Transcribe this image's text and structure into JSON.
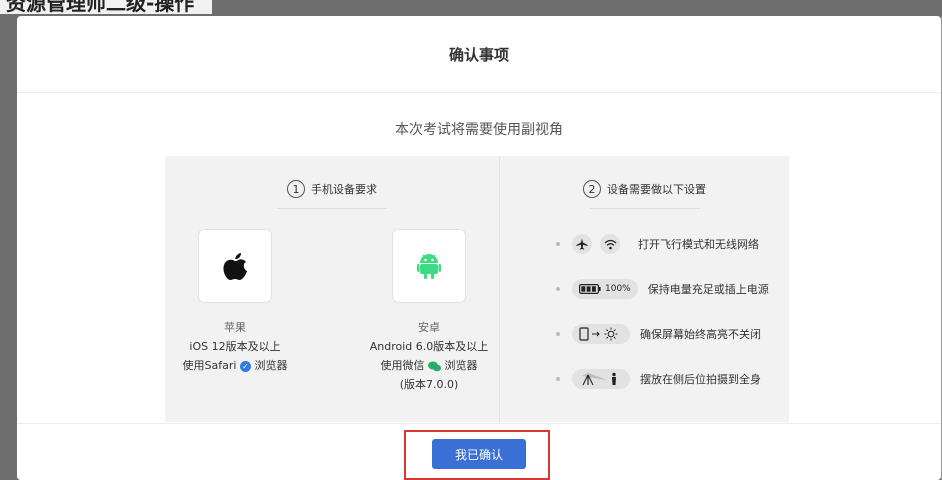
{
  "backdrop": {
    "title": "资源管理师二级-操作"
  },
  "modal": {
    "title": "确认事项",
    "subtitle": "本次考试将需要使用副视角",
    "confirm_label": "我已确认"
  },
  "steps": [
    {
      "number": "1",
      "label": "手机设备要求",
      "devices": [
        {
          "icon": "apple-logo-icon",
          "name": "苹果",
          "line1": "iOS 12版本及以上",
          "line2_prefix": "使用Safari",
          "line2_suffix": "浏览器",
          "line3": ""
        },
        {
          "icon": "android-logo-icon",
          "name": "安卓",
          "line1": "Android 6.0版本及以上",
          "line2_prefix": "使用微信",
          "line2_suffix": "浏览器",
          "line3": "(版本7.0.0)"
        }
      ]
    },
    {
      "number": "2",
      "label": "设备需要做以下设置",
      "requirements": [
        {
          "icons": [
            "airplane-icon",
            "wifi-icon"
          ],
          "text": "打开飞行模式和无线网络"
        },
        {
          "icons": [
            "battery-icon"
          ],
          "battery_label": "100%",
          "text": "保持电量充足或插上电源"
        },
        {
          "icons": [
            "phone-brightness-icon"
          ],
          "text": "确保屏幕始终高亮不关闭"
        },
        {
          "icons": [
            "tripod-person-icon"
          ],
          "text": "摆放在侧后位拍摄到全身"
        }
      ]
    }
  ],
  "colors": {
    "primary": "#3a70d6",
    "highlight": "#d93636",
    "panel": "#f2f2f2",
    "android": "#3ddc84",
    "safari": "#2e7ce6",
    "wechat": "#2aae67"
  }
}
